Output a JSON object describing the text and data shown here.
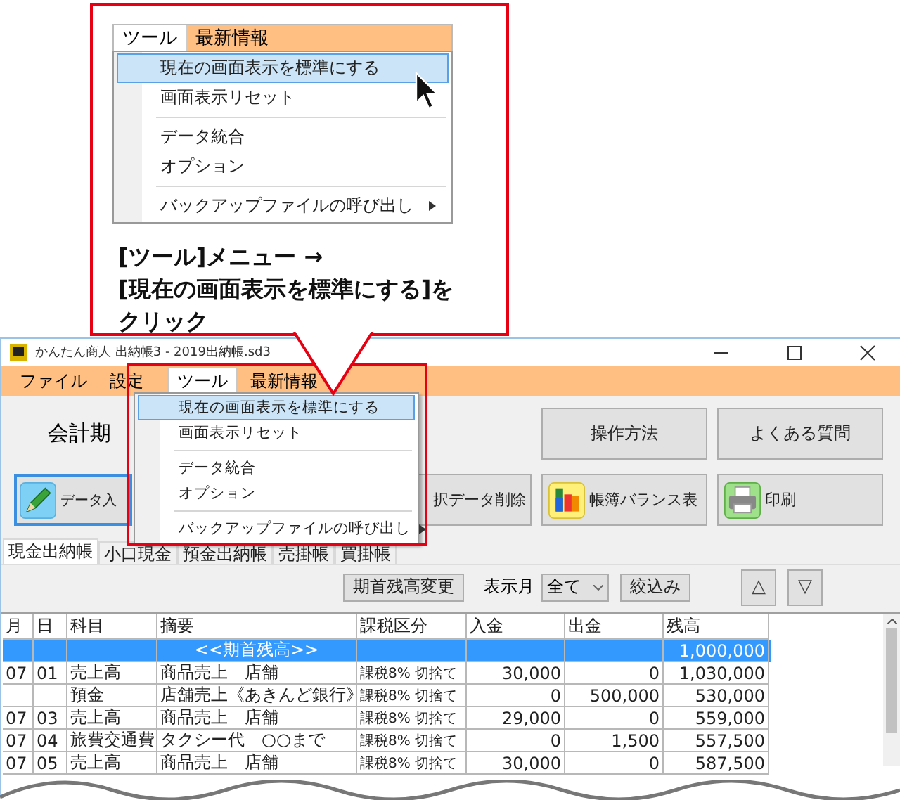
{
  "callout": {
    "menu_bar": [
      {
        "label": "ツール",
        "selected": true
      },
      {
        "label": "最新情報",
        "selected": false
      }
    ],
    "menu_items": [
      {
        "kind": "item",
        "label": "現在の画面表示を標準にする",
        "selected": true,
        "submenu": false
      },
      {
        "kind": "item",
        "label": "画面表示リセット",
        "selected": false,
        "submenu": false
      },
      {
        "kind": "separator"
      },
      {
        "kind": "item",
        "label": "データ統合",
        "selected": false,
        "submenu": false
      },
      {
        "kind": "item",
        "label": "オプション",
        "selected": false,
        "submenu": false
      },
      {
        "kind": "separator"
      },
      {
        "kind": "item",
        "label": "バックアップファイルの呼び出し",
        "selected": false,
        "submenu": true
      }
    ],
    "instruction": [
      "[ツール]メニュー →",
      "[現在の画面表示を標準にする]を",
      "クリック"
    ]
  },
  "window": {
    "title": "かんたん商人 出納帳3 - 2019出納帳.sd3",
    "menu_bar": [
      {
        "label": "ファイル",
        "selected": false
      },
      {
        "label": "設定",
        "selected": false
      },
      {
        "label": "ツール",
        "selected": true
      },
      {
        "label": "最新情報",
        "selected": false
      }
    ],
    "dropdown": [
      {
        "kind": "item",
        "label": "現在の画面表示を標準にする",
        "selected": true,
        "submenu": false
      },
      {
        "kind": "item",
        "label": "画面表示リセット",
        "selected": false,
        "submenu": false
      },
      {
        "kind": "separator"
      },
      {
        "kind": "item",
        "label": "データ統合",
        "selected": false,
        "submenu": false
      },
      {
        "kind": "item",
        "label": "オプション",
        "selected": false,
        "submenu": false
      },
      {
        "kind": "separator"
      },
      {
        "kind": "item",
        "label": "バックアップファイルの呼び出し",
        "selected": false,
        "submenu": true
      }
    ],
    "period_label": "会計期",
    "top_buttons": [
      "操作方法",
      "よくある質問"
    ],
    "action_buttons": [
      {
        "label": "データ入",
        "selected": true
      },
      {
        "label": "択データ削除",
        "selected": false
      },
      {
        "label": "帳簿バランス表",
        "selected": false
      },
      {
        "label": "印刷",
        "selected": false
      }
    ],
    "tabs": [
      {
        "label": "現金出納帳",
        "selected": true
      },
      {
        "label": "小口現金",
        "selected": false
      },
      {
        "label": "預金出納帳",
        "selected": false
      },
      {
        "label": "売掛帳",
        "selected": false
      },
      {
        "label": "買掛帳",
        "selected": false
      }
    ],
    "filter": {
      "opening_button": "期首残高変更",
      "month_label": "表示月",
      "month_value": "全て",
      "filter_button": "絞込み",
      "up_button": "△",
      "down_button": "▽"
    },
    "table": {
      "columns": [
        "月",
        "日",
        "科目",
        "摘要",
        "課税区分",
        "入金",
        "出金",
        "残高"
      ],
      "rows": [
        {
          "selected": true,
          "cells": [
            "",
            "",
            "",
            "<<期首残高>>",
            "",
            "",
            "",
            "1,000,000"
          ]
        },
        {
          "selected": false,
          "cells": [
            "07",
            "01",
            "売上高",
            "商品売上　店舗",
            "課税8% 切捨て",
            "30,000",
            "0",
            "1,030,000"
          ]
        },
        {
          "selected": false,
          "cells": [
            "",
            "",
            "預金",
            "店舗売上《あきんど銀行》",
            "課税8% 切捨て",
            "0",
            "500,000",
            "530,000"
          ]
        },
        {
          "selected": false,
          "cells": [
            "07",
            "03",
            "売上高",
            "商品売上　店舗",
            "課税8% 切捨て",
            "29,000",
            "0",
            "559,000"
          ]
        },
        {
          "selected": false,
          "cells": [
            "07",
            "04",
            "旅費交通費",
            "タクシー代　○○まで",
            "課税8% 切捨て",
            "0",
            "1,500",
            "557,500"
          ]
        },
        {
          "selected": false,
          "cells": [
            "07",
            "05",
            "売上高",
            "商品売上　店舗",
            "課税8% 切捨て",
            "30,000",
            "0",
            "587,500"
          ]
        }
      ]
    }
  }
}
